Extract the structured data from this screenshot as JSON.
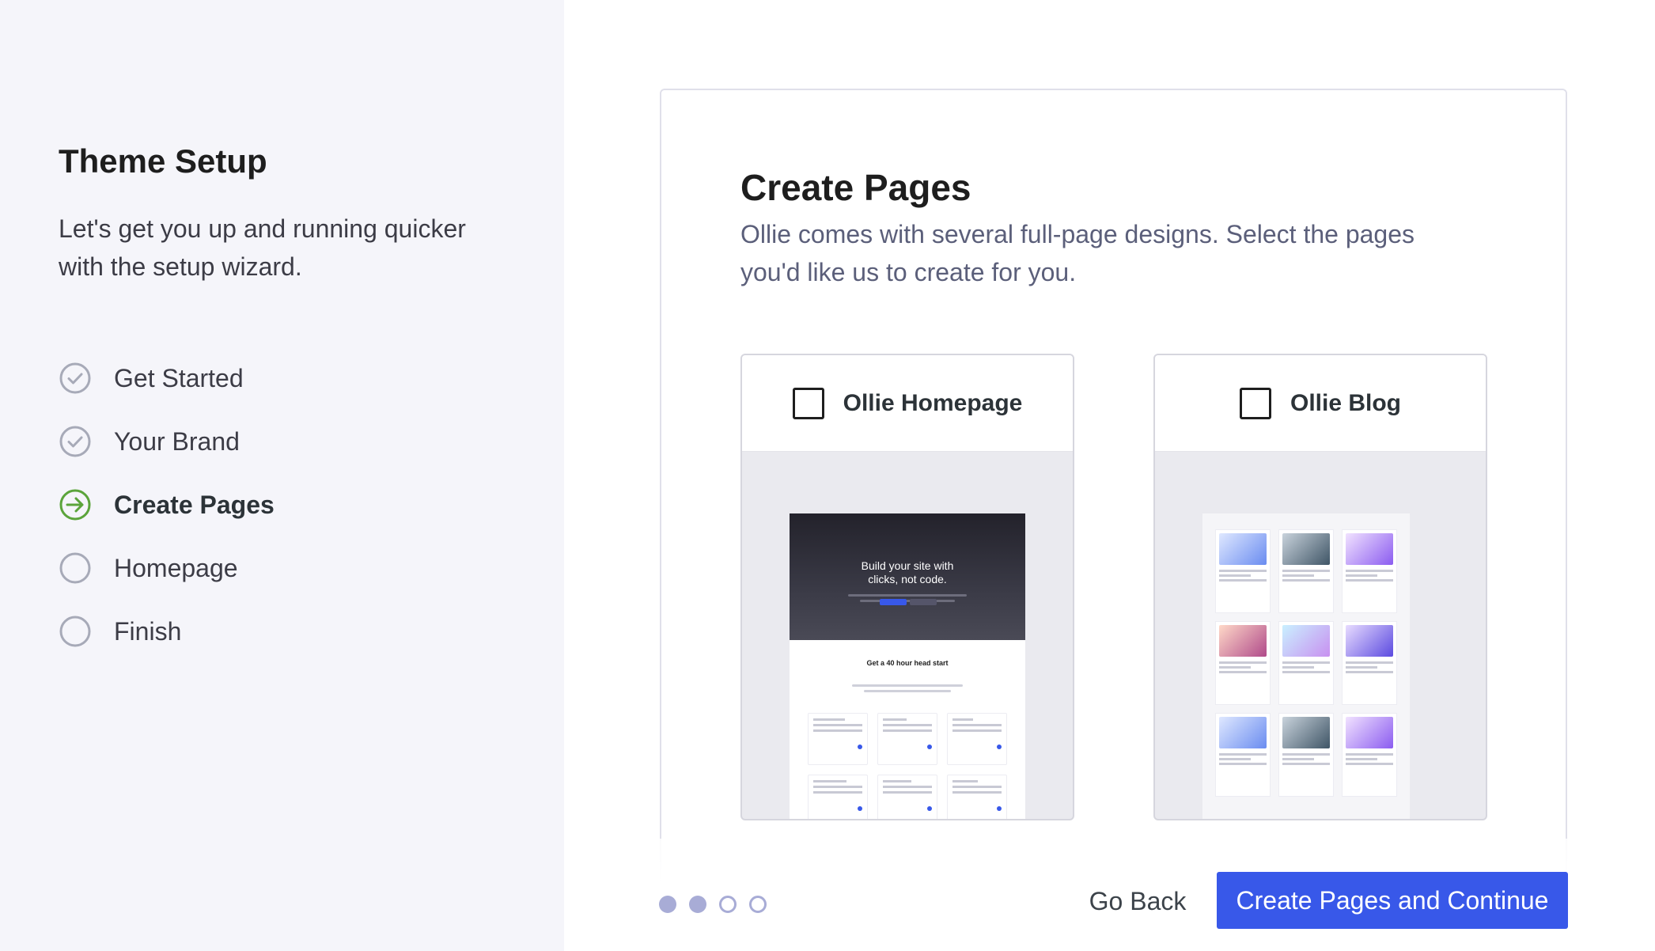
{
  "sidebar": {
    "title": "Theme Setup",
    "description": "Let's get you up and running quicker with the setup wizard.",
    "steps": [
      {
        "label": "Get Started",
        "status": "complete"
      },
      {
        "label": "Your Brand",
        "status": "complete"
      },
      {
        "label": "Create Pages",
        "status": "current"
      },
      {
        "label": "Homepage",
        "status": "pending"
      },
      {
        "label": "Finish",
        "status": "pending"
      }
    ]
  },
  "main": {
    "title": "Create Pages",
    "description": "Ollie comes with several full-page designs. Select the pages you'd like us to create for you.",
    "pages": [
      {
        "label": "Ollie Homepage",
        "checked": false
      },
      {
        "label": "Ollie Blog",
        "checked": false
      }
    ],
    "homepage_preview": {
      "hero_title": "Build your site with clicks, not code.",
      "section_title": "Get a 40 hour head start"
    }
  },
  "footer": {
    "progress": {
      "current": 2,
      "total": 4
    },
    "back_label": "Go Back",
    "continue_label": "Create Pages and Continue"
  },
  "colors": {
    "accent": "#3858e9",
    "active_step": "#5ba43b",
    "muted_step": "#a7aab8",
    "sidebar_bg": "#f5f5fa"
  }
}
